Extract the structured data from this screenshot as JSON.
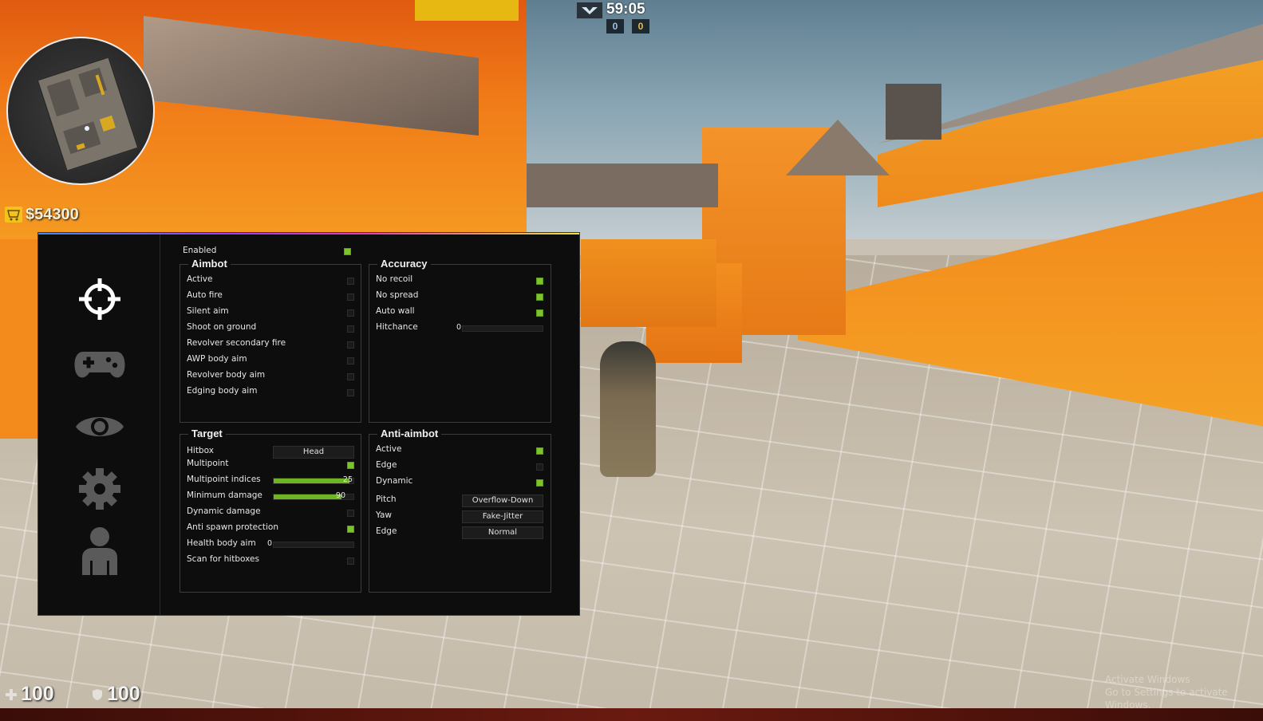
{
  "hud": {
    "round_timer": "59:05",
    "score_ct": "0",
    "score_t": "0",
    "money": "$54300",
    "health": "100",
    "armor": "100",
    "watermark_line1": "Activate Windows",
    "watermark_line2": "Go to Settings to activate Windows."
  },
  "menu": {
    "accent_colors": [
      "#3b8cff",
      "#9a3bff",
      "#e23bbd",
      "#f0e23b"
    ],
    "check_on_color": "#7cc42a",
    "tabs": [
      {
        "icon": "crosshair-icon",
        "active": true
      },
      {
        "icon": "gamepad-icon",
        "active": false
      },
      {
        "icon": "eye-icon",
        "active": false
      },
      {
        "icon": "gear-icon",
        "active": false
      },
      {
        "icon": "user-icon",
        "active": false
      }
    ],
    "enabled": {
      "label": "Enabled",
      "checked": true
    },
    "aimbot": {
      "title": "Aimbot",
      "items": [
        {
          "label": "Active",
          "checked": false
        },
        {
          "label": "Auto fire",
          "checked": false
        },
        {
          "label": "Silent aim",
          "checked": false
        },
        {
          "label": "Shoot on ground",
          "checked": false
        },
        {
          "label": "Revolver secondary fire",
          "checked": false
        },
        {
          "label": "AWP body aim",
          "checked": false
        },
        {
          "label": "Revolver body aim",
          "checked": false
        },
        {
          "label": "Edging body aim",
          "checked": false
        }
      ]
    },
    "accuracy": {
      "title": "Accuracy",
      "items": [
        {
          "label": "No recoil",
          "checked": true
        },
        {
          "label": "No spread",
          "checked": true
        },
        {
          "label": "Auto wall",
          "checked": true
        }
      ],
      "hitchance": {
        "label": "Hitchance",
        "value": "0",
        "fraction": 0
      }
    },
    "target": {
      "title": "Target",
      "hitbox": {
        "label": "Hitbox",
        "value": "Head"
      },
      "multipoint": {
        "label": "Multipoint",
        "checked": true
      },
      "multipoint_indices": {
        "label": "Multipoint indices",
        "value": "25",
        "fraction": 0.95
      },
      "minimum_damage": {
        "label": "Minimum damage",
        "value": "90",
        "fraction": 0.85
      },
      "dynamic_damage": {
        "label": "Dynamic damage",
        "checked": false
      },
      "anti_spawn": {
        "label": "Anti spawn protection",
        "checked": true
      },
      "health_body_aim": {
        "label": "Health body aim",
        "value": "0",
        "fraction": 0
      },
      "scan_hitboxes": {
        "label": "Scan for hitboxes",
        "checked": false
      }
    },
    "antiaim": {
      "title": "Anti-aimbot",
      "active": {
        "label": "Active",
        "checked": true
      },
      "edge": {
        "label": "Edge",
        "checked": false
      },
      "dynamic": {
        "label": "Dynamic",
        "checked": true
      },
      "pitch": {
        "label": "Pitch",
        "value": "Overflow-Down"
      },
      "yaw": {
        "label": "Yaw",
        "value": "Fake-Jitter"
      },
      "edge_mode": {
        "label": "Edge",
        "value": "Normal"
      }
    }
  }
}
